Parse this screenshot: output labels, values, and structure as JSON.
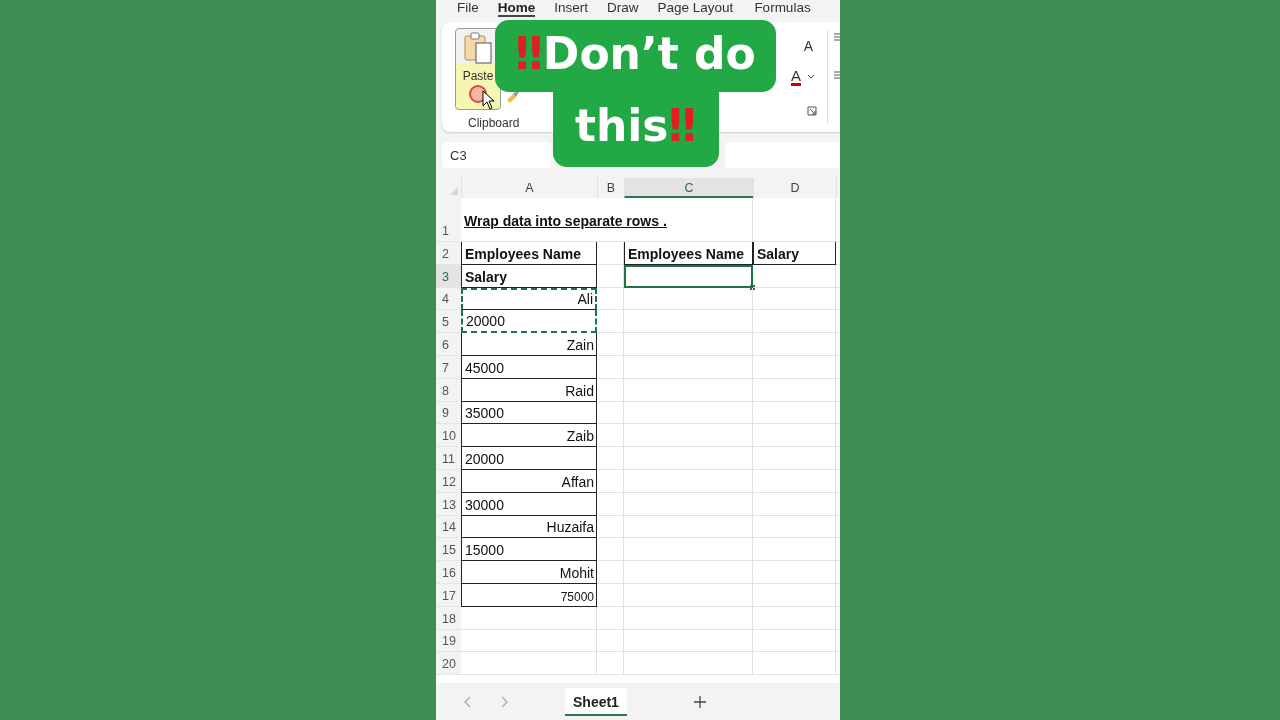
{
  "ribbon_tabs": [
    {
      "label": "File",
      "selected": false
    },
    {
      "label": "Home",
      "selected": true
    },
    {
      "label": "Insert",
      "selected": false
    },
    {
      "label": "Draw",
      "selected": false
    },
    {
      "label": "Page Layout",
      "selected": false
    },
    {
      "label": "Formulas",
      "selected": false
    }
  ],
  "ribbon": {
    "paste_label": "Paste",
    "group_label": "Clipboard",
    "font_letters": [
      "A",
      "A"
    ]
  },
  "caption": {
    "lines": [
      {
        "parts": [
          {
            "text": "‼",
            "kind": "alert"
          },
          {
            "text": "Don’t do",
            "kind": "plain"
          }
        ]
      },
      {
        "parts": [
          {
            "text": "this",
            "kind": "plain"
          },
          {
            "text": "‼",
            "kind": "alert"
          }
        ]
      }
    ]
  },
  "name_box": "C3",
  "columns": [
    {
      "label": "A",
      "selected": false
    },
    {
      "label": "B",
      "selected": false
    },
    {
      "label": "C",
      "selected": true
    },
    {
      "label": "D",
      "selected": false
    }
  ],
  "rows": [
    {
      "header": "1",
      "selected": false,
      "cells": {
        "A": {
          "text": "Wrap data into separate rows .",
          "bold": true,
          "underline": true,
          "right_aligned": false
        }
      }
    },
    {
      "header": "2",
      "selected": false,
      "cells": {
        "A": {
          "text": "Employees Name",
          "bold": true,
          "right_aligned": false,
          "boxed": true
        },
        "C": {
          "text": "Employees Name",
          "bold": true,
          "right_aligned": false,
          "boxed": true
        },
        "D": {
          "text": "Salary",
          "bold": true,
          "right_aligned": false,
          "boxed": true
        }
      }
    },
    {
      "header": "3",
      "selected": true,
      "cells": {
        "A": {
          "text": "Salary",
          "bold": true,
          "right_aligned": false,
          "boxed": true
        },
        "C": {
          "selected": true
        }
      }
    },
    {
      "header": "4",
      "selected": false,
      "cells": {
        "A": {
          "text": "Ali",
          "right_aligned": true,
          "boxed": true,
          "copied": true
        }
      }
    },
    {
      "header": "5",
      "selected": false,
      "cells": {
        "A": {
          "text": "20000",
          "right_aligned": false,
          "boxed": true,
          "copied": true
        }
      }
    },
    {
      "header": "6",
      "selected": false,
      "cells": {
        "A": {
          "text": "Zain",
          "right_aligned": true,
          "boxed": true
        }
      }
    },
    {
      "header": "7",
      "selected": false,
      "cells": {
        "A": {
          "text": "45000",
          "right_aligned": false,
          "boxed": true
        }
      }
    },
    {
      "header": "8",
      "selected": false,
      "cells": {
        "A": {
          "text": "Raid",
          "right_aligned": true,
          "boxed": true
        }
      }
    },
    {
      "header": "9",
      "selected": false,
      "cells": {
        "A": {
          "text": "35000",
          "right_aligned": false,
          "boxed": true
        }
      }
    },
    {
      "header": "10",
      "selected": false,
      "cells": {
        "A": {
          "text": "Zaib",
          "right_aligned": true,
          "boxed": true
        }
      }
    },
    {
      "header": "11",
      "selected": false,
      "cells": {
        "A": {
          "text": "20000",
          "right_aligned": false,
          "boxed": true
        }
      }
    },
    {
      "header": "12",
      "selected": false,
      "cells": {
        "A": {
          "text": "Affan",
          "right_aligned": true,
          "boxed": true
        }
      }
    },
    {
      "header": "13",
      "selected": false,
      "cells": {
        "A": {
          "text": "30000",
          "right_aligned": false,
          "boxed": true
        }
      }
    },
    {
      "header": "14",
      "selected": false,
      "cells": {
        "A": {
          "text": "Huzaifa",
          "right_aligned": true,
          "boxed": true
        }
      }
    },
    {
      "header": "15",
      "selected": false,
      "cells": {
        "A": {
          "text": "15000",
          "right_aligned": false,
          "boxed": true
        }
      }
    },
    {
      "header": "16",
      "selected": false,
      "cells": {
        "A": {
          "text": "Mohit",
          "right_aligned": true,
          "boxed": true
        }
      }
    },
    {
      "header": "17",
      "selected": false,
      "cells": {
        "A": {
          "text": "75000",
          "right_aligned": true,
          "boxed": true,
          "small": true
        }
      }
    },
    {
      "header": "18",
      "selected": false,
      "cells": {}
    },
    {
      "header": "19",
      "selected": false,
      "cells": {}
    },
    {
      "header": "20",
      "selected": false,
      "cells": {}
    }
  ],
  "sheet_tabs": [
    {
      "label": "Sheet1",
      "selected": true
    }
  ]
}
